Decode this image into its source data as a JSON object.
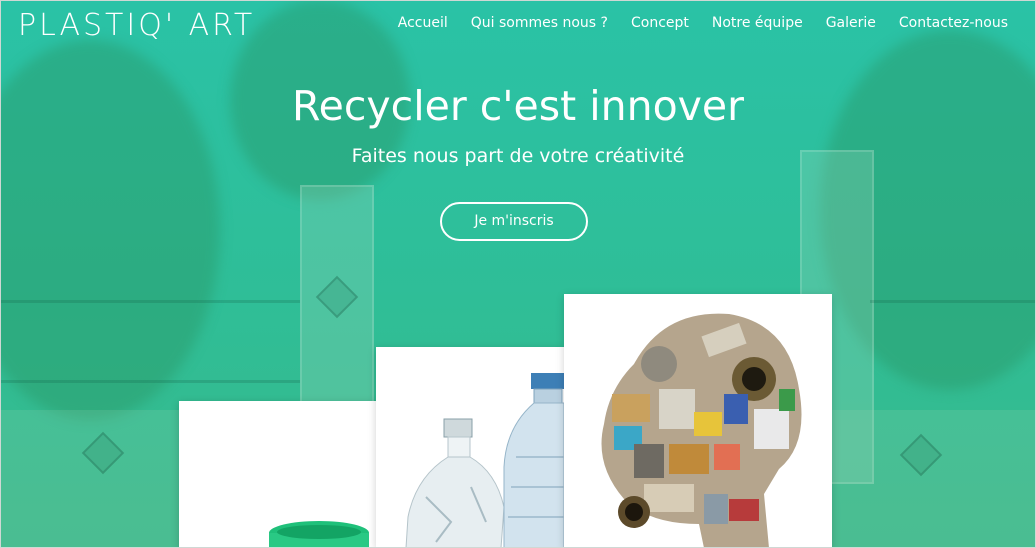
{
  "brand": {
    "logo": "PLASTIQ' ART"
  },
  "nav": {
    "items": [
      {
        "label": "Accueil"
      },
      {
        "label": "Qui sommes nous ?"
      },
      {
        "label": "Concept"
      },
      {
        "label": "Notre équipe"
      },
      {
        "label": "Galerie"
      },
      {
        "label": "Contactez-nous"
      }
    ]
  },
  "hero": {
    "title": "Recycler c'est innover",
    "subtitle": "Faites nous part de votre créativité",
    "cta_label": "Je m'inscris"
  },
  "gallery": {
    "cards": [
      {
        "icon": "green-bucket-icon"
      },
      {
        "icon": "plastic-bottles-icon"
      },
      {
        "icon": "recycled-waste-head-icon"
      }
    ]
  },
  "colors": {
    "accent": "#2fbe9a",
    "text": "#ffffff"
  }
}
